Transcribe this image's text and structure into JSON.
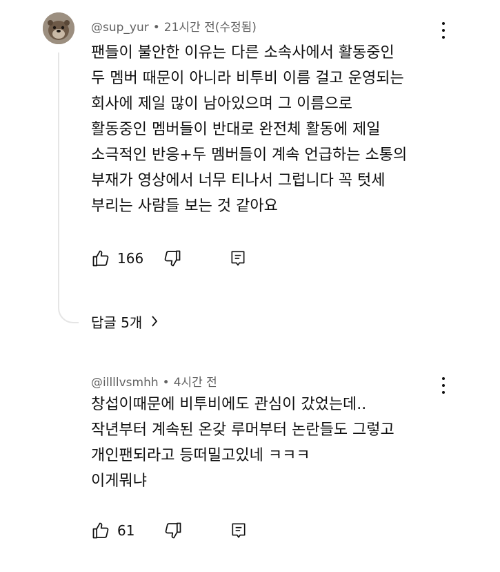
{
  "comments": [
    {
      "author": "@sup_yur",
      "separator": "•",
      "time": "21시간 전(수정됨)",
      "lines": [
        "팬들이 불안한 이유는 다른 소속사에서 활동중인",
        "두 멤버 때문이 아니라 비투비 이름 걸고 운영되는",
        "회사에 제일 많이 남아있으며 그 이름으로",
        "활동중인 멤버들이 반대로 완전체 활동에 제일",
        "소극적인 반응+두 멤버들이 계속 언급하는 소통의",
        "부재가 영상에서 너무 티나서 그럽니다 꼭 텃세",
        "부리는 사람들 보는 것 같아요"
      ],
      "likes": "166",
      "replies_label": "답글 5개"
    },
    {
      "author": "@illllvsmhh",
      "separator": "•",
      "time": "4시간 전",
      "lines": [
        "창섭이때문에 비투비에도 관심이 갔었는데..",
        "작년부터 계속된 온갖 루머부터 논란들도 그렇고",
        "개인팬되라고 등떠밀고있네 ㅋㅋㅋ",
        "이게뭐냐"
      ],
      "likes": "61"
    }
  ],
  "icons": {
    "like": "thumbs-up-icon",
    "dislike": "thumbs-down-icon",
    "reply": "reply-comment-icon",
    "menu": "more-vertical-icon",
    "expand": "chevron-right-icon"
  }
}
